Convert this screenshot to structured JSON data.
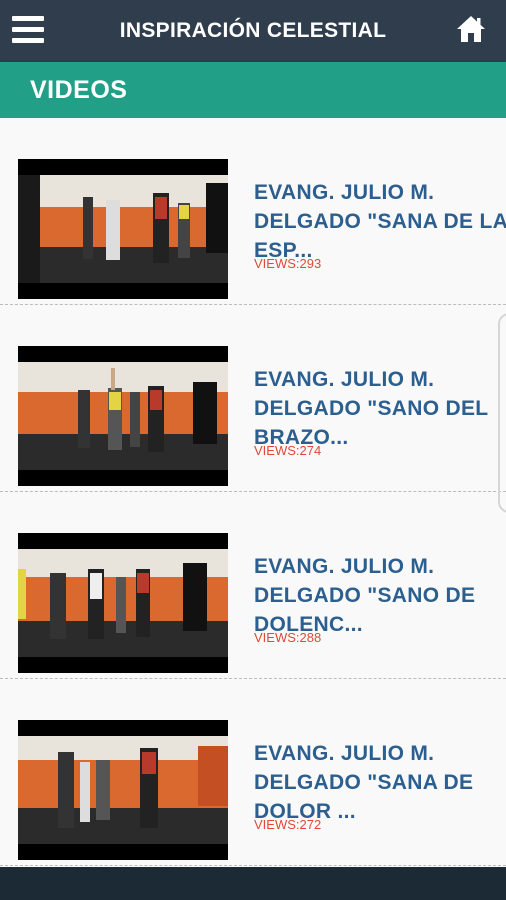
{
  "header": {
    "title": "INSPIRACIÓN CELESTIAL",
    "menu_icon": "hamburger-menu-icon",
    "home_icon": "home-icon"
  },
  "section": {
    "title": "VIDEOS"
  },
  "videos": [
    {
      "title_lines": [
        "EVANG. JULIO M.",
        "DELGADO \"SANA DE LA",
        "ESP..."
      ],
      "views": "VIEWS:293"
    },
    {
      "title_lines": [
        "EVANG. JULIO M.",
        "DELGADO \"SANO DEL",
        "BRAZO..."
      ],
      "views": "VIEWS:274"
    },
    {
      "title_lines": [
        "EVANG. JULIO M.",
        "DELGADO \"SANO DE",
        "DOLENC..."
      ],
      "views": "VIEWS:288"
    },
    {
      "title_lines": [
        "EVANG. JULIO M.",
        "DELGADO \"SANA DE",
        "DOLOR ..."
      ],
      "views": "VIEWS:272"
    }
  ],
  "colors": {
    "topbar": "#2f3d4c",
    "section": "#22a087",
    "title": "#2c5f8f",
    "views": "#e0483a"
  }
}
